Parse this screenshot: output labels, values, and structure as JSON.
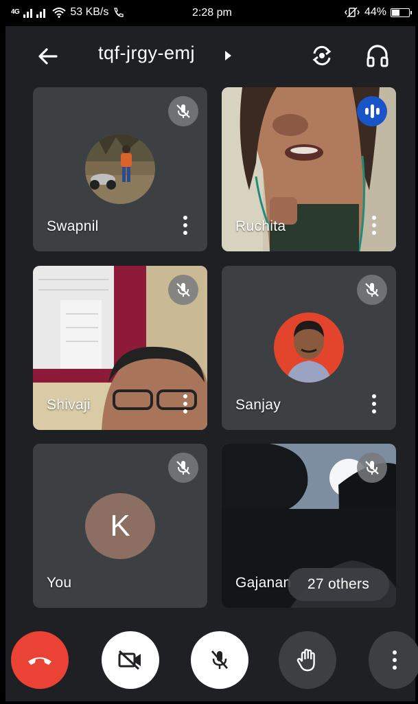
{
  "status_bar": {
    "network": "4G",
    "speed": "53 KB/s",
    "time": "2:28 pm",
    "battery": "44%",
    "battery_level": 0.44
  },
  "header": {
    "meeting_code": "tqf-jrgy-emj"
  },
  "participants": [
    {
      "name": "Swapnil",
      "muted": true
    },
    {
      "name": "Ruchita",
      "muted": false,
      "speaking": true
    },
    {
      "name": "Shivaji",
      "muted": true
    },
    {
      "name": "Sanjay",
      "muted": true
    },
    {
      "name": "You",
      "muted": true,
      "avatar_letter": "K"
    },
    {
      "name": "Gajanan",
      "muted": true
    }
  ],
  "others_chip": "27 others",
  "colors": {
    "background": "#1f2023",
    "tile": "#3c4043",
    "end_call": "#ea4335",
    "speaking_badge": "#1a55c8",
    "avatar_k": "#8d6e63"
  },
  "controls": [
    "end-call",
    "camera-off",
    "mic-off",
    "raise-hand",
    "more-options"
  ]
}
